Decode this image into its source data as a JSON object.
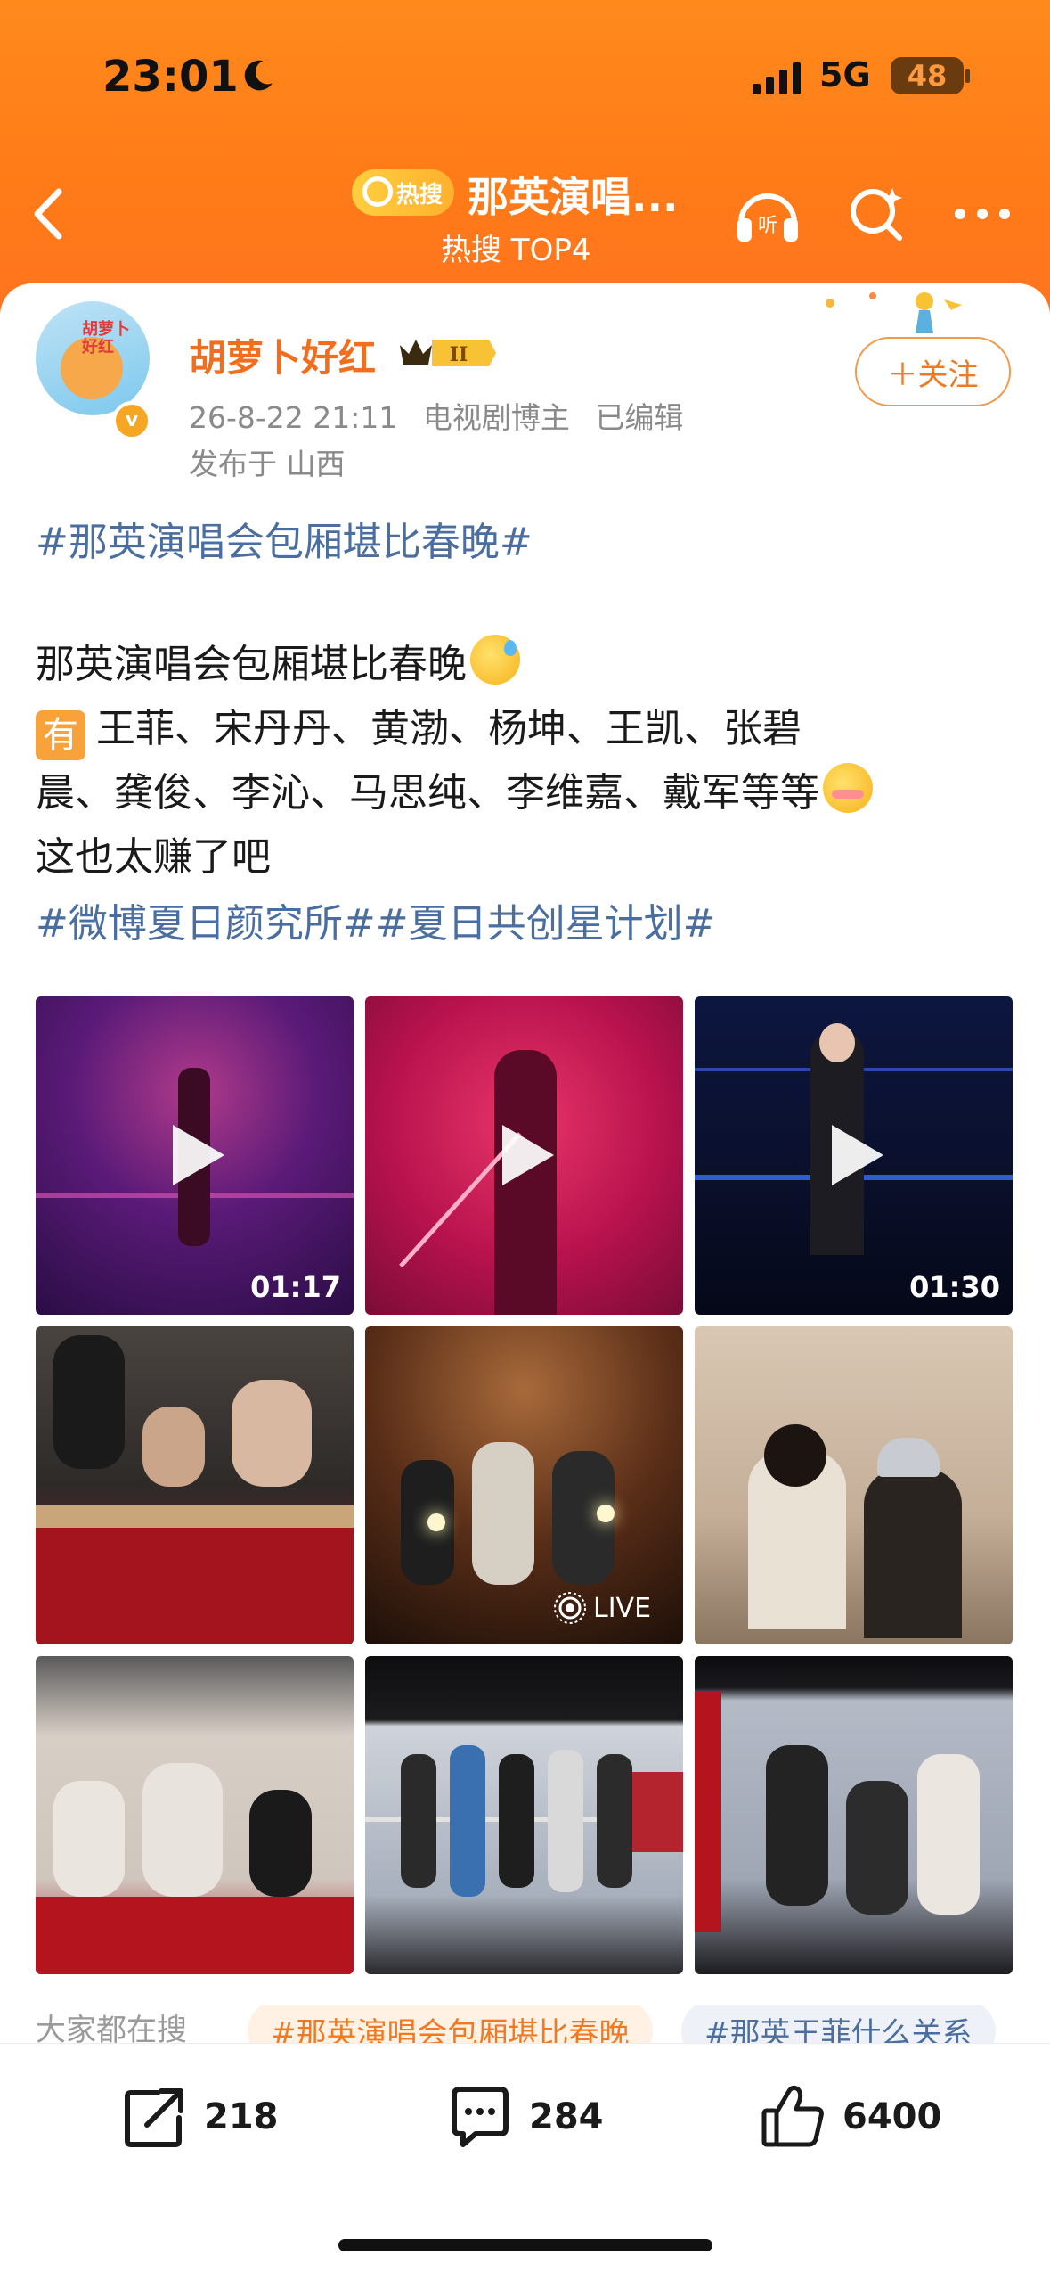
{
  "status_bar": {
    "time": "23:01",
    "network": "5G",
    "battery": "48"
  },
  "nav": {
    "hot_badge": "热搜",
    "title": "那英演唱...",
    "subtitle": "热搜 TOP4"
  },
  "author": {
    "name": "胡萝卜好红",
    "avatar_text": "胡萝卜好红",
    "rank": "II",
    "date": "26-8-22 21:11",
    "role": "电视剧博主",
    "edited": "已编辑",
    "location": "发布于 山西",
    "follow_label": "＋关注"
  },
  "post": {
    "hashtag_title": "#那英演唱会包厢堪比春晚#",
    "line1": "那英演唱会包厢堪比春晚",
    "you_badge": "有",
    "line2": "王菲、宋丹丹、黄渤、杨坤、王凯、张碧",
    "line3": "晨、龚俊、李沁、马思纯、李维嘉、戴军等等",
    "line4": "这也太赚了吧",
    "hashtag_topics": "#微博夏日颜究所##夏日共创星计划#"
  },
  "media": [
    {
      "type": "video",
      "duration": "01:17"
    },
    {
      "type": "video",
      "duration": ""
    },
    {
      "type": "video",
      "duration": "01:30"
    },
    {
      "type": "image"
    },
    {
      "type": "live",
      "label": "LIVE"
    },
    {
      "type": "image"
    },
    {
      "type": "image"
    },
    {
      "type": "image"
    },
    {
      "type": "image"
    }
  ],
  "search": {
    "label": "大家都在搜",
    "chip1": "#那英演唱会包厢堪比春晚",
    "chip2": "#那英王菲什么关系"
  },
  "actions": {
    "share_count": "218",
    "comment_count": "284",
    "like_count": "6400"
  },
  "colors": {
    "header_orange": "#ff7a18",
    "link_blue": "#4a6ea0",
    "username_orange": "#f06e1e"
  }
}
